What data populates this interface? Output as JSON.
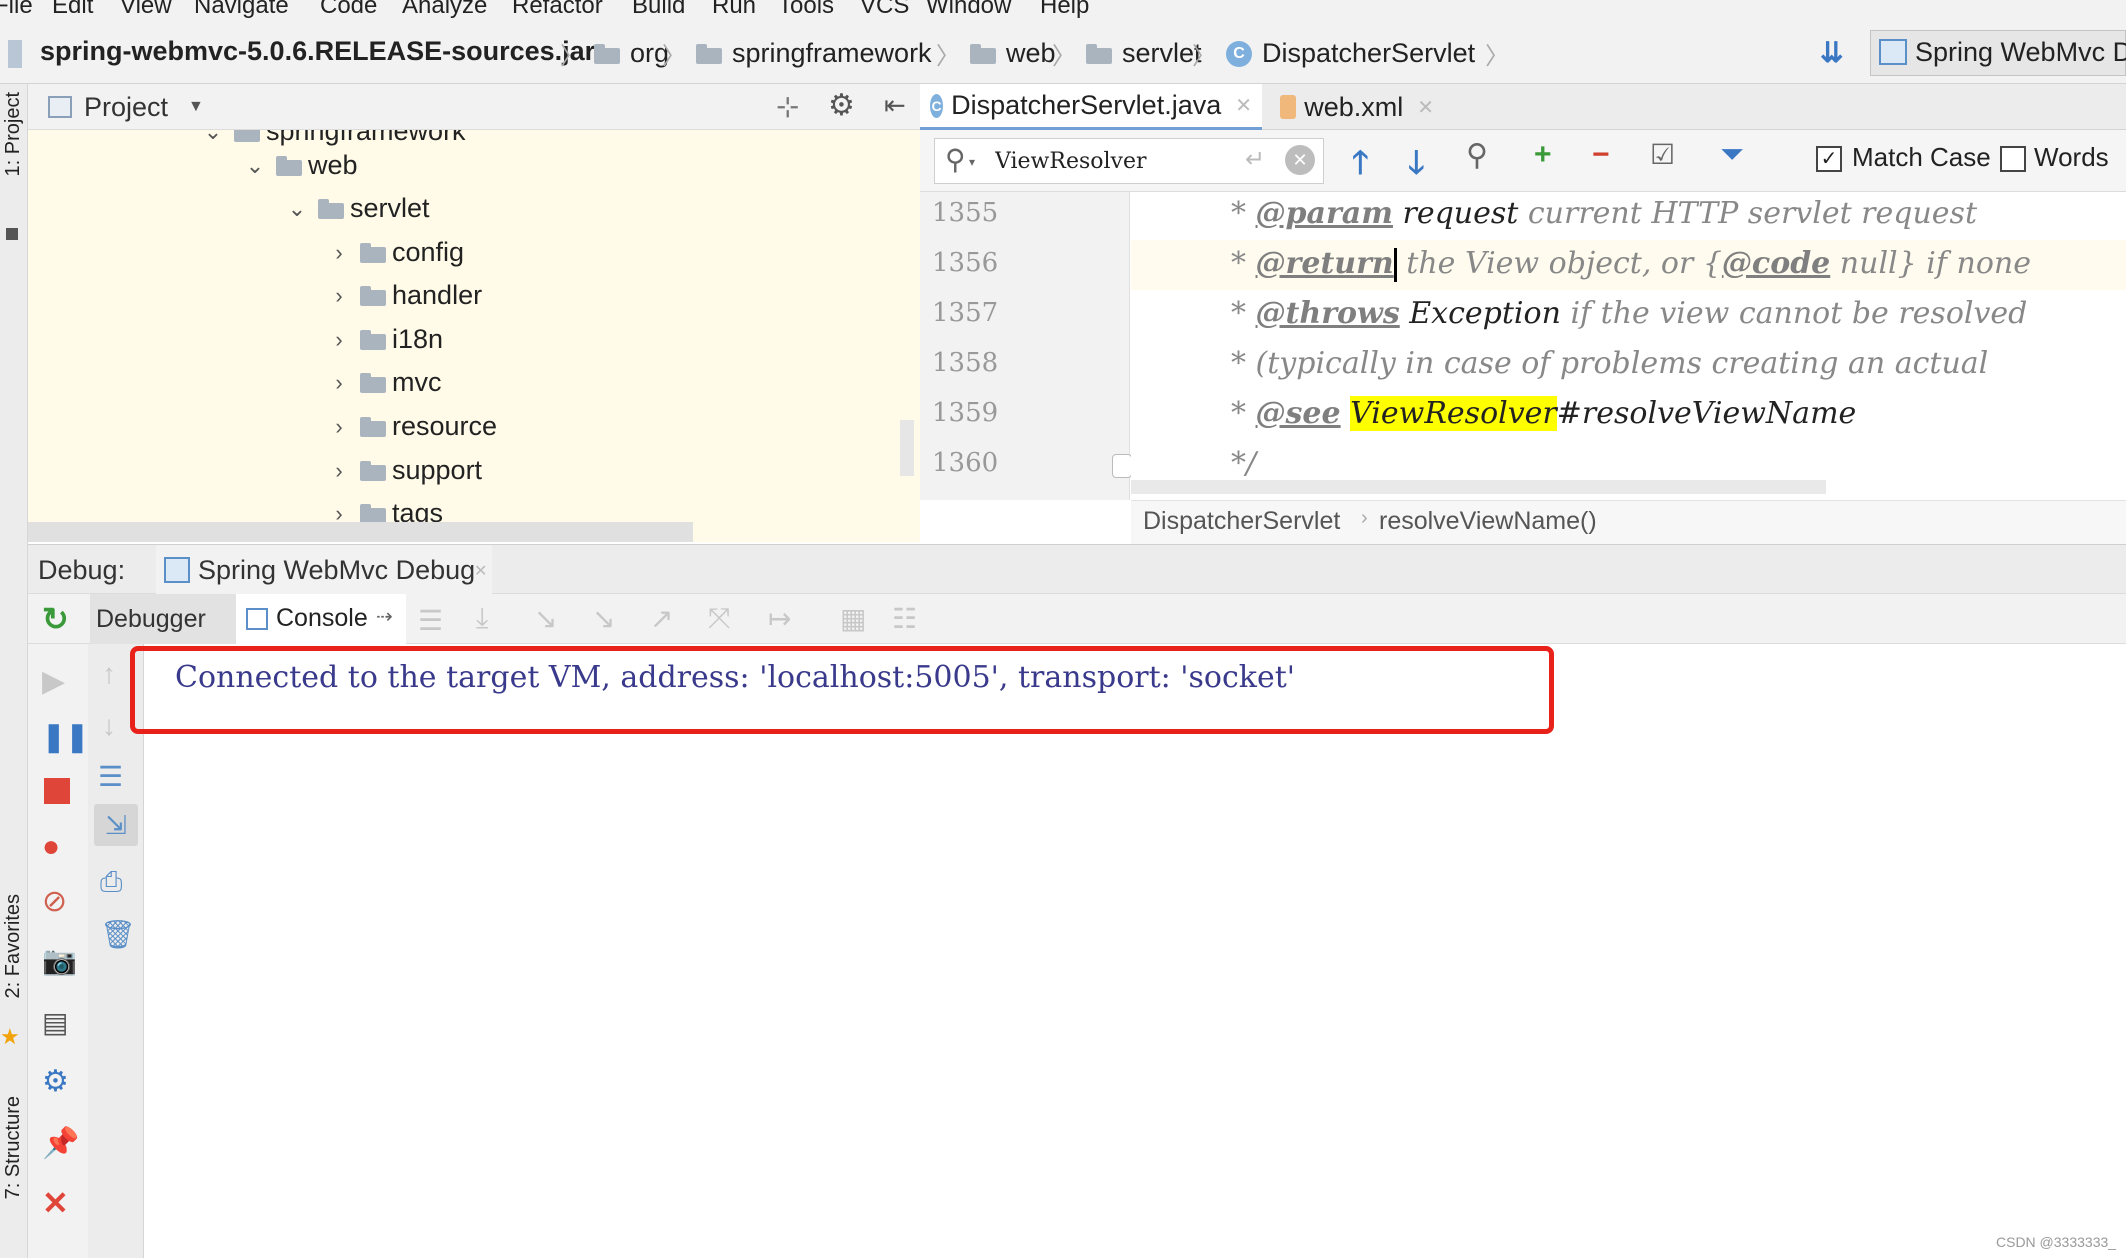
{
  "menubar": {
    "items": [
      "File",
      "Edit",
      "View",
      "Navigate",
      "Code",
      "Analyze",
      "Refactor",
      "Build",
      "Run",
      "Tools",
      "VCS",
      "Window",
      "Help"
    ]
  },
  "navbar": {
    "jar": "spring-webmvc-5.0.6.RELEASE-sources.jar",
    "crumbs": [
      "org",
      "springframework",
      "web",
      "servlet",
      "DispatcherServlet"
    ],
    "run_config": "Spring WebMvc D"
  },
  "left_strip": {
    "project_tab": "1: Project",
    "favorites_tab": "2: Favorites",
    "structure_tab": "7: Structure"
  },
  "project_panel": {
    "title": "Project",
    "tree": [
      {
        "label": "springframework",
        "expanded": true
      },
      {
        "label": "web",
        "expanded": true
      },
      {
        "label": "servlet",
        "expanded": true
      },
      {
        "label": "config",
        "expanded": false
      },
      {
        "label": "handler",
        "expanded": false
      },
      {
        "label": "i18n",
        "expanded": false
      },
      {
        "label": "mvc",
        "expanded": false
      },
      {
        "label": "resource",
        "expanded": false
      },
      {
        "label": "support",
        "expanded": false
      },
      {
        "label": "tags",
        "expanded": false
      }
    ]
  },
  "editor": {
    "tabs": [
      {
        "label": "DispatcherServlet.java",
        "active": true
      },
      {
        "label": "web.xml",
        "active": false
      }
    ],
    "search": {
      "value": "ViewResolver",
      "match_case_label": "Match Case",
      "match_case_checked": true,
      "words_label": "Words",
      "words_checked": false
    },
    "lines": [
      {
        "num": "1355"
      },
      {
        "num": "1356"
      },
      {
        "num": "1357"
      },
      {
        "num": "1358"
      },
      {
        "num": "1359"
      },
      {
        "num": "1360"
      }
    ],
    "code": {
      "l1_star": "* ",
      "l1_tag": "@param",
      "l1_name": " request",
      "l1_rest": " current HTTP servlet request",
      "l2_star": "* ",
      "l2_tag": "@return",
      "l2_rest1": " the View object, or ",
      "l2_brace_open": "{",
      "l2_code": "@code",
      "l2_rest2": " null} if none",
      "l3_star": "* ",
      "l3_tag": "@throws",
      "l3_name": " Exception",
      "l3_rest": " if the view cannot be resolved",
      "l4": "* (typically in case of problems creating an actual",
      "l5_star": "* ",
      "l5_tag": "@see",
      "l5_space": " ",
      "l5_hl": "ViewResolver",
      "l5_rest": "#resolveViewName",
      "l6": "*/"
    },
    "breadcrumb": {
      "class": "DispatcherServlet",
      "method": "resolveViewName()"
    }
  },
  "debug": {
    "label": "Debug:",
    "session": "Spring WebMvc Debug",
    "tabs": {
      "debugger": "Debugger",
      "console": "Console"
    },
    "console_output": "Connected to the target VM, address: 'localhost:5005', transport: 'socket'"
  },
  "watermark": "CSDN @3333333_",
  "colors": {
    "highlight": "#ffff00",
    "annotation_box": "#e8221a",
    "console_text": "#3a3a8c",
    "tree_bg": "#fffbe8"
  }
}
